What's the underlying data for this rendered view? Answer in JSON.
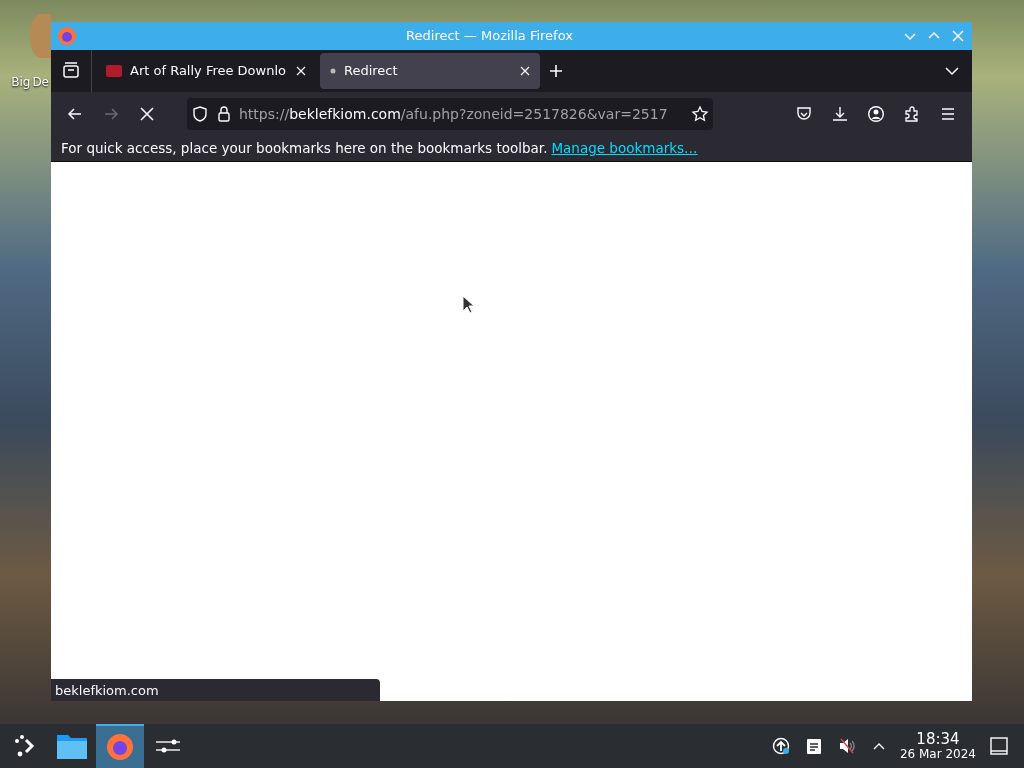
{
  "desktop_icon": {
    "label_lines": [
      "Big",
      "De"
    ]
  },
  "window": {
    "title": "Redirect — Mozilla Firefox"
  },
  "tabs": [
    {
      "title": "Art of Rally Free Downlo",
      "selected": false,
      "loading": false
    },
    {
      "title": "Redirect",
      "selected": true,
      "loading": true
    }
  ],
  "toolbar": {
    "back_disabled": false,
    "forward_disabled": true,
    "loading": true
  },
  "url": {
    "scheme": "https://",
    "host": "beklefkiom.com",
    "path": "/afu.php?zoneid=2517826&var=2517"
  },
  "bookmarks_bar": {
    "text": "For quick access, place your bookmarks here on the bookmarks toolbar.",
    "link": "Manage bookmarks…"
  },
  "status_url": "beklefkiom.com",
  "taskbar": {
    "apps": [
      {
        "kind": "files",
        "selected": false
      },
      {
        "kind": "firefox",
        "selected": true
      },
      {
        "kind": "settings",
        "selected": false
      }
    ],
    "time": "18:34",
    "date": "26 Mar 2024"
  }
}
